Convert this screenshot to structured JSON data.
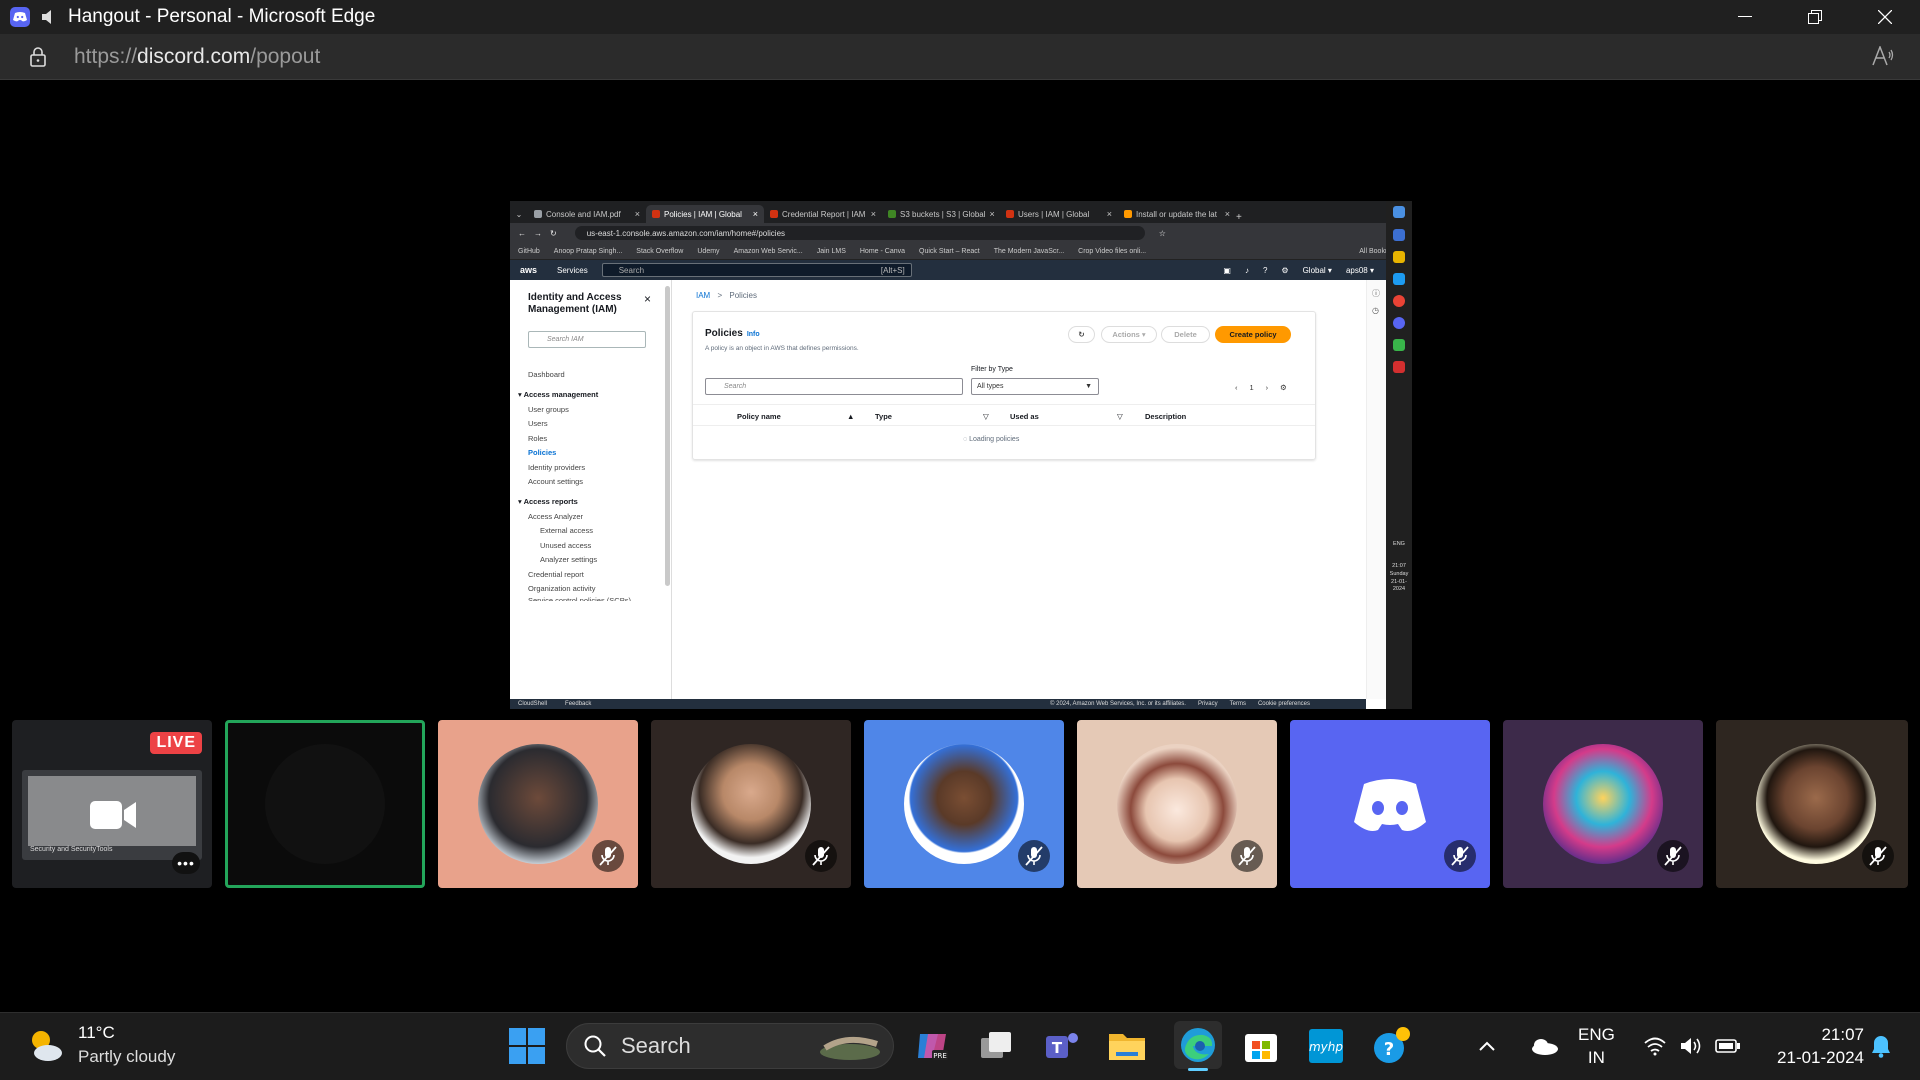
{
  "window": {
    "title": "Hangout - Personal - Microsoft Edge",
    "url_protocol": "https://",
    "url_domain": "discord.com",
    "url_path": "/popout"
  },
  "stream": {
    "tabs": [
      {
        "label": "Console and IAM.pdf",
        "color": "#9aa0a6"
      },
      {
        "label": "Policies | IAM | Global",
        "color": "#d13212"
      },
      {
        "label": "Credential Report | IAM",
        "color": "#d13212"
      },
      {
        "label": "S3 buckets | S3 | Global",
        "color": "#3f8624"
      },
      {
        "label": "Users | IAM | Global",
        "color": "#d13212"
      },
      {
        "label": "Install or update the lat",
        "color": "#ff9900"
      }
    ],
    "url": "us-east-1.console.aws.amazon.com/iam/home#/policies",
    "bookmarks": [
      "GitHub",
      "Anoop Pratap Singh...",
      "Stack Overflow",
      "Udemy",
      "Amazon Web Servic...",
      "Jain LMS",
      "Home - Canva",
      "Quick Start – React",
      "The Modern JavaScr...",
      "Crop Video files onli...",
      "All Bookmarks"
    ],
    "aws": {
      "logo": "aws",
      "services": "Services",
      "search_placeholder": "Search",
      "search_shortcut": "[Alt+S]",
      "region": "Global ▾",
      "account": "aps08 ▾"
    },
    "sidenav": {
      "title": "Identity and Access Management (IAM)",
      "search_placeholder": "Search IAM",
      "dashboard": "Dashboard",
      "access_management": "Access management",
      "user_groups": "User groups",
      "users": "Users",
      "roles": "Roles",
      "policies": "Policies",
      "identity_providers": "Identity providers",
      "account_settings": "Account settings",
      "access_reports": "Access reports",
      "access_analyzer": "Access Analyzer",
      "external_access": "External access",
      "unused_access": "Unused access",
      "analyzer_settings": "Analyzer settings",
      "credential_report": "Credential report",
      "organization_activity": "Organization activity",
      "scp": "Service control policies (SCPs)"
    },
    "breadcrumb": {
      "root": "IAM",
      "sep": ">",
      "current": "Policies"
    },
    "panel": {
      "title": "Policies",
      "info": "Info",
      "description": "A policy is an object in AWS that defines permissions.",
      "actions": "Actions ▾",
      "delete": "Delete",
      "create": "Create policy",
      "filter_label": "Filter by Type",
      "search_placeholder": "Search",
      "filter_value": "All types",
      "page": "1",
      "columns": [
        "Policy name",
        "Type",
        "Used as",
        "Description"
      ],
      "loading": "Loading policies"
    },
    "footer": {
      "cloudshell": "CloudShell",
      "feedback": "Feedback",
      "copyright": "© 2024, Amazon Web Services, Inc. or its affiliates.",
      "privacy": "Privacy",
      "terms": "Terms",
      "cookies": "Cookie preferences"
    },
    "win_tray": {
      "lang": "ENG",
      "time": "21:07",
      "day": "Sunday",
      "date": "21-01-2024"
    }
  },
  "tiles": {
    "live_badge": "LIVE",
    "stream_caption": "Security and SecurityTools",
    "more": "•••"
  },
  "taskbar": {
    "temperature": "11°C",
    "weather": "Partly cloudy",
    "search": "Search",
    "lang_line1": "ENG",
    "lang_line2": "IN",
    "time": "21:07",
    "date": "21-01-2024"
  }
}
